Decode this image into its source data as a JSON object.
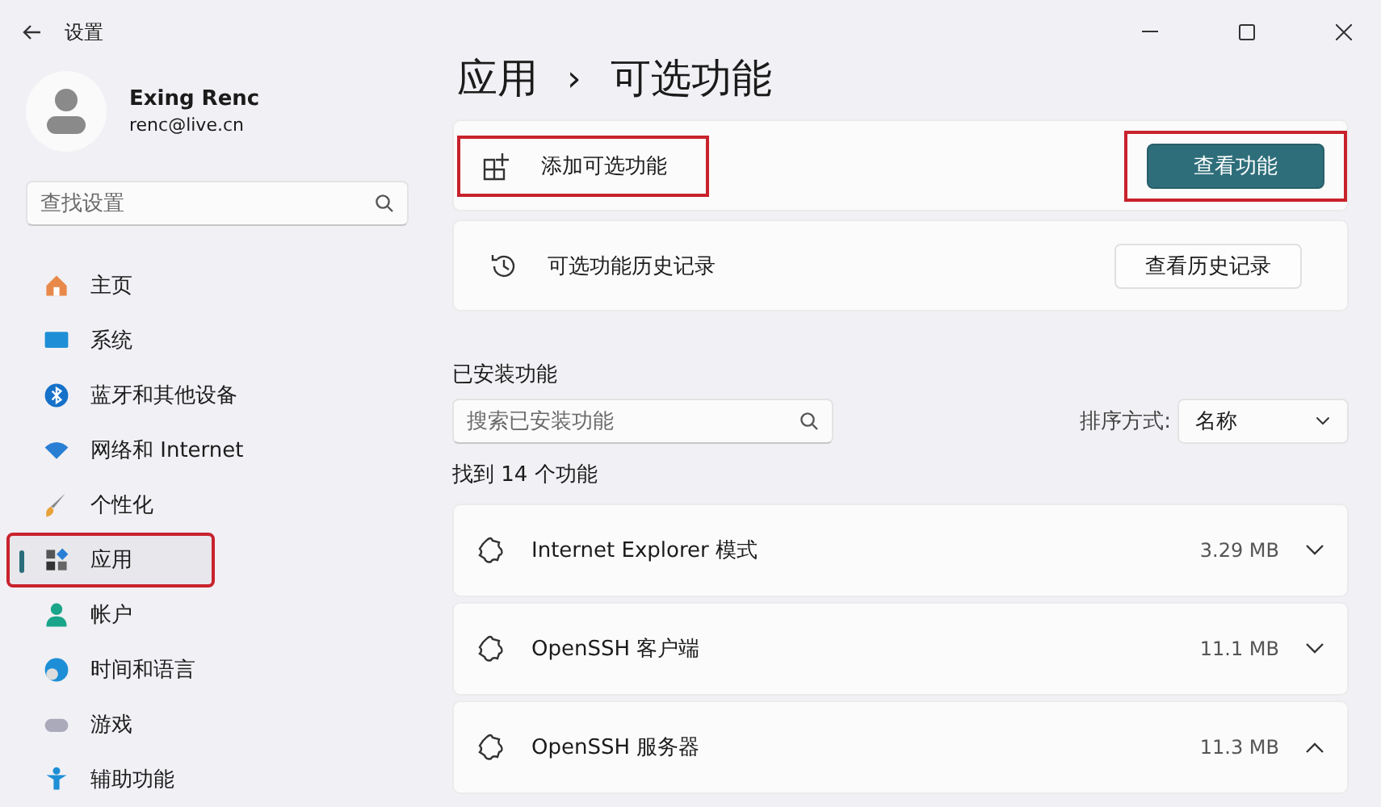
{
  "window": {
    "title": "设置"
  },
  "profile": {
    "name": "Exing Renc",
    "email": "renc@live.cn"
  },
  "sidebar": {
    "search": {
      "placeholder": "查找设置"
    },
    "items": [
      {
        "label": "主页",
        "selected": false,
        "annotated": false
      },
      {
        "label": "系统",
        "selected": false,
        "annotated": false
      },
      {
        "label": "蓝牙和其他设备",
        "selected": false,
        "annotated": false
      },
      {
        "label": "网络和 Internet",
        "selected": false,
        "annotated": false
      },
      {
        "label": "个性化",
        "selected": false,
        "annotated": false
      },
      {
        "label": "应用",
        "selected": true,
        "annotated": true
      },
      {
        "label": "帐户",
        "selected": false,
        "annotated": false
      },
      {
        "label": "时间和语言",
        "selected": false,
        "annotated": false
      },
      {
        "label": "游戏",
        "selected": false,
        "annotated": false
      },
      {
        "label": "辅助功能",
        "selected": false,
        "annotated": false
      }
    ]
  },
  "breadcrumb": {
    "parent": "应用",
    "separator": "›",
    "current": "可选功能"
  },
  "cards": [
    {
      "label": "添加可选功能",
      "label_annotated": true,
      "button": "查看功能",
      "accent": true,
      "button_annotated": true
    },
    {
      "label": "可选功能历史记录",
      "label_annotated": false,
      "button": "查看历史记录",
      "accent": false,
      "button_annotated": false
    }
  ],
  "installed": {
    "heading": "已安装功能",
    "search": {
      "placeholder": "搜索已安装功能"
    },
    "sort_label": "排序方式:",
    "sort_value": "名称",
    "count": "找到 14 个功能",
    "features": [
      {
        "name": "Internet Explorer 模式",
        "size": "3.29 MB",
        "expanded": false
      },
      {
        "name": "OpenSSH 客户端",
        "size": "11.1 MB",
        "expanded": false
      },
      {
        "name": "OpenSSH 服务器",
        "size": "11.3 MB",
        "expanded": true
      }
    ]
  }
}
